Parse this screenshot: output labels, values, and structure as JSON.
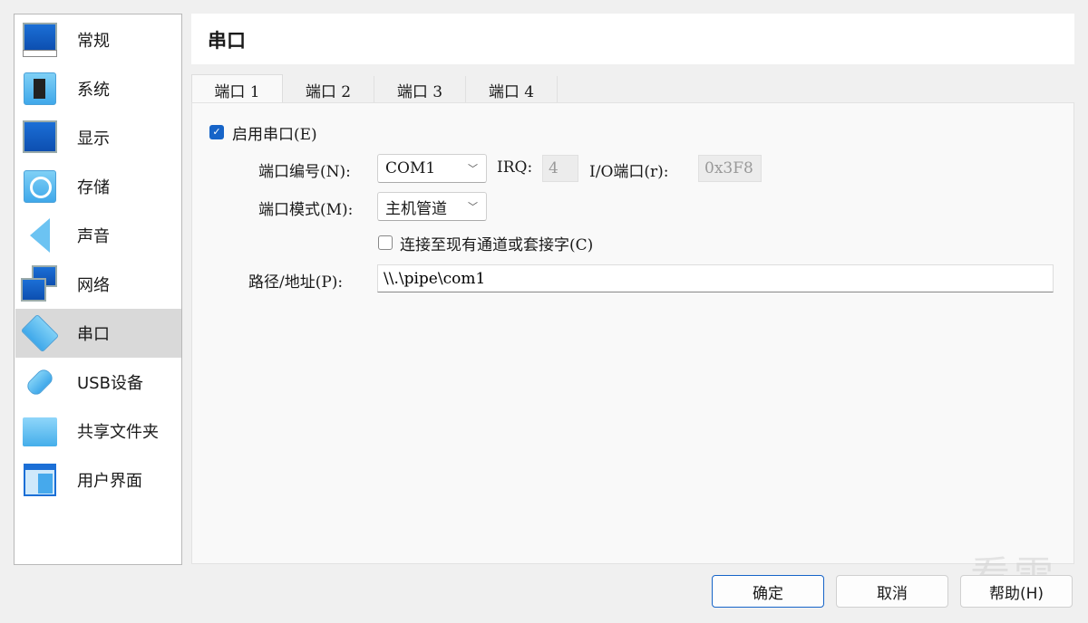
{
  "sidebar": {
    "items": [
      {
        "label": "常规",
        "icon": "general-monitor-icon"
      },
      {
        "label": "系统",
        "icon": "system-chip-icon"
      },
      {
        "label": "显示",
        "icon": "display-monitor-icon"
      },
      {
        "label": "存储",
        "icon": "storage-disk-icon"
      },
      {
        "label": "声音",
        "icon": "audio-speaker-icon"
      },
      {
        "label": "网络",
        "icon": "network-icon"
      },
      {
        "label": "串口",
        "icon": "serial-port-icon",
        "selected": true
      },
      {
        "label": "USB设备",
        "icon": "usb-icon"
      },
      {
        "label": "共享文件夹",
        "icon": "shared-folder-icon"
      },
      {
        "label": "用户界面",
        "icon": "user-interface-icon"
      }
    ]
  },
  "header": {
    "title": "串口"
  },
  "tabs": [
    {
      "label": "端口 1",
      "active": true
    },
    {
      "label": "端口 2"
    },
    {
      "label": "端口 3"
    },
    {
      "label": "端口 4"
    }
  ],
  "form": {
    "enable_label": "启用串口(E)",
    "enable_checked": true,
    "port_number_label": "端口编号(N):",
    "port_number_value": "COM1",
    "irq_label": "IRQ:",
    "irq_value": "4",
    "io_label": "I/O端口(r):",
    "io_value": "0x3F8",
    "mode_label": "端口模式(M):",
    "mode_value": "主机管道",
    "connect_label": "连接至现有通道或套接字(C)",
    "connect_checked": false,
    "path_label": "路径/地址(P):",
    "path_value": "\\\\.\\pipe\\com1"
  },
  "buttons": {
    "ok": "确定",
    "cancel": "取消",
    "help": "帮助(H)"
  },
  "watermark": "看雪",
  "colors": {
    "accent": "#1664c8",
    "selected_bg": "#d9d9d9"
  }
}
